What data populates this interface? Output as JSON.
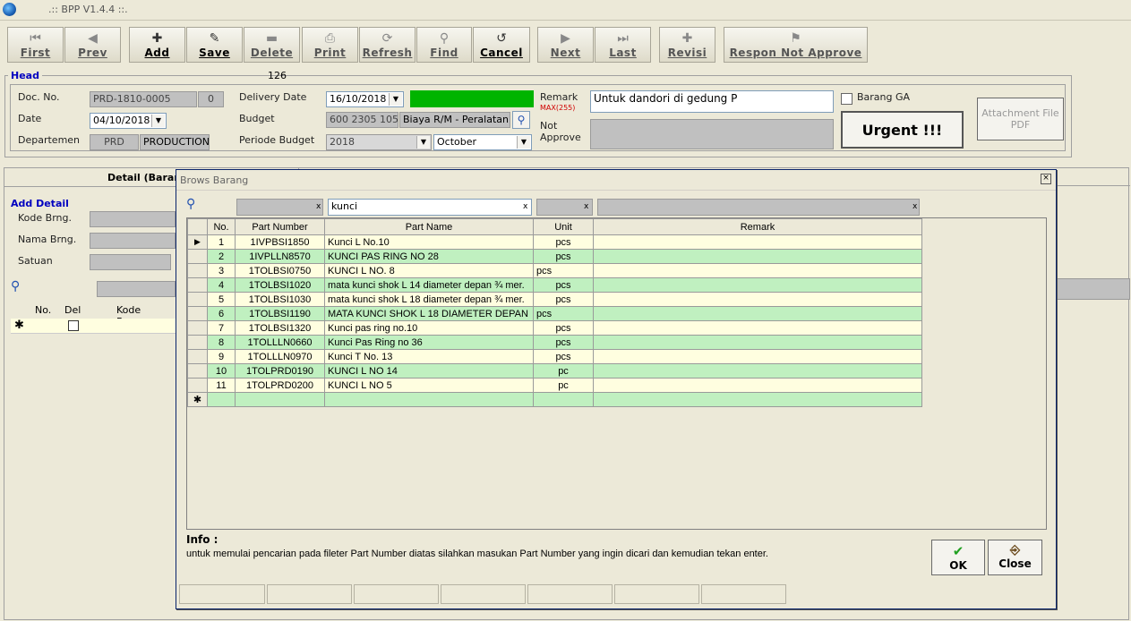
{
  "window": {
    "title": ".:: BPP V1.4.4 ::."
  },
  "toolbar": [
    {
      "label": "First",
      "icon": "⏮",
      "active": false
    },
    {
      "label": "Prev",
      "icon": "◀",
      "active": false
    },
    {
      "label": "Add",
      "icon": "✚",
      "active": true
    },
    {
      "label": "Save",
      "icon": "✎",
      "active": true
    },
    {
      "label": "Delete",
      "icon": "▬",
      "active": false
    },
    {
      "label": "Print",
      "icon": "⎙",
      "active": false
    },
    {
      "label": "Refresh",
      "icon": "⟳",
      "active": false
    },
    {
      "label": "Find",
      "icon": "⚲",
      "active": false
    },
    {
      "label": "Cancel",
      "icon": "↺",
      "active": true
    },
    {
      "label": "Next",
      "icon": "▶",
      "active": false
    },
    {
      "label": "Last",
      "icon": "⏭",
      "active": false
    },
    {
      "label": "Revisi",
      "icon": "✚",
      "active": false
    },
    {
      "label": "Respon Not Approve",
      "icon": "⚑",
      "active": false
    }
  ],
  "head": {
    "section_label": "Head",
    "counter": "126",
    "doc_no_label": "Doc. No.",
    "doc_no": "PRD-1810-0005",
    "doc_no_rev": "0",
    "date_label": "Date",
    "date": "04/10/2018",
    "departemen_label": "Departemen",
    "dept_code": "PRD",
    "dept_name": "PRODUCTION",
    "delivery_label": "Delivery Date",
    "delivery_date": "16/10/2018",
    "budget_label": "Budget",
    "budget_code": "600 2305 105",
    "budget_name": "Biaya R/M - Peralatan",
    "periode_label": "Periode Budget",
    "periode_year": "2018",
    "periode_month": "October",
    "remark_label": "Remark",
    "remark_max": "MAX(255)",
    "remark": "Untuk dandori di gedung P",
    "not_approve_label": "Not Approve",
    "barang_ga_label": "Barang GA",
    "urgent_label": "Urgent !!!",
    "attachment_label": "Attachment File PDF",
    "status_color": "#00b400"
  },
  "detail": {
    "tab_label": "Detail (Barang)",
    "add_label": "Add Detail",
    "kode_label": "Kode Brng.",
    "nama_label": "Nama Brng.",
    "satuan_label": "Satuan",
    "cols": [
      "No.",
      "Del",
      "Kode Barang"
    ]
  },
  "dialog": {
    "title": "Brows Barang",
    "filter_value": "kunci",
    "columns": [
      "No.",
      "Part Number",
      "Part Name",
      "Unit",
      "Remark"
    ],
    "rows": [
      {
        "no": "1",
        "pn": "1IVPBSI1850",
        "name": "Kunci L No.10",
        "unit": "pcs",
        "remark": ""
      },
      {
        "no": "2",
        "pn": "1IVPLLN8570",
        "name": "KUNCI PAS RING NO 28",
        "unit": "pcs",
        "remark": ""
      },
      {
        "no": "3",
        "pn": "1TOLBSI0750",
        "name": "KUNCI L NO. 8",
        "unit": "pcs",
        "remark": ""
      },
      {
        "no": "4",
        "pn": "1TOLBSI1020",
        "name": "mata kunci shok L 14 diameter depan ¾ mer.",
        "unit": "pcs",
        "remark": ""
      },
      {
        "no": "5",
        "pn": "1TOLBSI1030",
        "name": "mata kunci shok L 18 diameter depan ¾ mer.",
        "unit": "pcs",
        "remark": ""
      },
      {
        "no": "6",
        "pn": "1TOLBSI1190",
        "name": "MATA KUNCI SHOK L 18 DIAMETER DEPAN",
        "unit": "pcs",
        "remark": ""
      },
      {
        "no": "7",
        "pn": "1TOLBSI1320",
        "name": "Kunci pas ring no.10",
        "unit": "pcs",
        "remark": ""
      },
      {
        "no": "8",
        "pn": "1TOLLLN0660",
        "name": "Kunci Pas Ring no 36",
        "unit": "pcs",
        "remark": ""
      },
      {
        "no": "9",
        "pn": "1TOLLLN0970",
        "name": "Kunci T No. 13",
        "unit": "pcs",
        "remark": ""
      },
      {
        "no": "10",
        "pn": "1TOLPRD0190",
        "name": "KUNCI L NO 14",
        "unit": "pc",
        "remark": ""
      },
      {
        "no": "11",
        "pn": "1TOLPRD0200",
        "name": "KUNCI L NO 5",
        "unit": "pc",
        "remark": ""
      }
    ],
    "info_label": "Info :",
    "info_text": "untuk memulai pencarian pada fileter Part Number diatas silahkan masukan Part Number yang ingin dicari dan kemudian tekan enter.",
    "ok_label": "OK",
    "close_label": "Close"
  }
}
